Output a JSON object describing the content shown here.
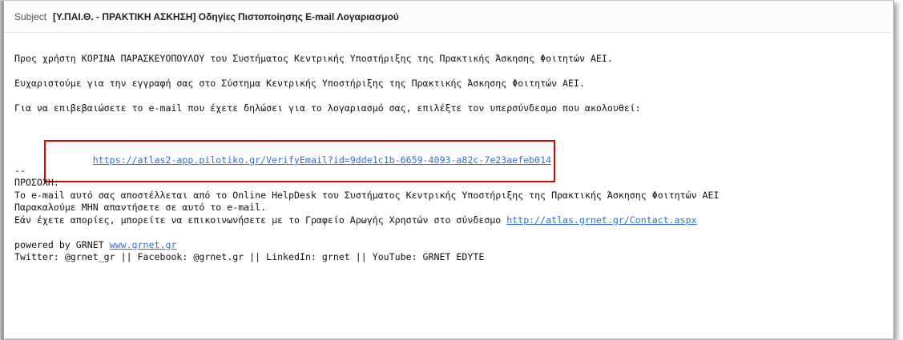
{
  "subject": {
    "label": "Subject",
    "text": "[Υ.ΠΑΙ.Θ. - ΠΡΑΚΤΙΚΗ ΑΣΚΗΣΗ] Οδηγίες Πιστοποίησης E-mail Λογαριασμού"
  },
  "email": {
    "greeting": "Προς χρήστη ΚΟΡΙΝΑ ΠΑΡΑΣΚΕΥΟΠΟΥΛΟΥ του Συστήματος Κεντρικής Υποστήριξης της Πρακτικής Άσκησης Φοιτητών ΑΕΙ.",
    "thanks": "Ευχαριστούμε για την εγγραφή σας στο Σύστημα Κεντρικής Υποστήριξης της Πρακτικής Άσκησης Φοιτητών ΑΕΙ.",
    "instruction": "Για να επιβεβαιώσετε το e-mail που έχετε δηλώσει για το λογαριασμό σας, επιλέξτε τον υπερσύνδεσμο που ακολουθεί:",
    "verify_link": "https://atlas2-app.pilotiko.gr/VerifyEmail?id=9dde1c1b-6659-4093-a82c-7e23aefeb014",
    "separator": "--",
    "notice_title": "ΠΡΟΣΟΧΗ:",
    "notice_line1": "Το e-mail αυτό σας αποστέλλεται από το Online HelpDesk του Συστήματος Κεντρικής Υποστήριξης της Πρακτικής Άσκησης Φοιτητών ΑΕΙ",
    "notice_line2": "Παρακαλούμε ΜΗΝ απαντήσετε σε αυτό το e-mail.",
    "notice_line3_prefix": "Εάν έχετε απορίες, μπορείτε να επικοινωνήσετε με το Γραφείο Αρωγής Χρηστών στο σύνδεσμο ",
    "contact_link": "http://atlas.grnet.gr/Contact.aspx",
    "powered_prefix": "powered by GRNET ",
    "grnet_link": "www.grnet.gr",
    "social": "Twitter: @grnet_gr || Facebook: @grnet.gr || LinkedIn: grnet || YouTube: GRNET EDYTE"
  },
  "colors": {
    "link": "#2e6fd6",
    "highlight_box": "#e00000"
  }
}
